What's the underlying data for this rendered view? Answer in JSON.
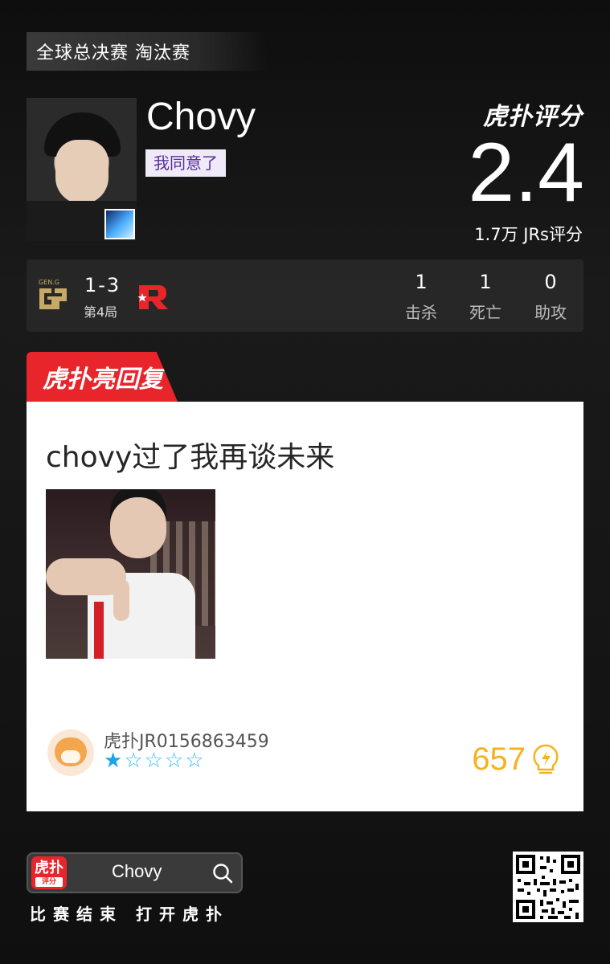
{
  "stage": "全球总决赛 淘汰赛",
  "player": {
    "name": "Chovy",
    "tag": "我同意了"
  },
  "rating": {
    "brand": "虎扑评分",
    "score": "2.4",
    "count": "1.7万 JRs评分"
  },
  "match": {
    "score": "1-3",
    "game": "第4局",
    "stats": [
      {
        "value": "1",
        "label": "击杀"
      },
      {
        "value": "1",
        "label": "死亡"
      },
      {
        "value": "0",
        "label": "助攻"
      }
    ]
  },
  "highlight": {
    "tab": "虎扑亮回复",
    "text": "chovy过了我再谈未来",
    "user": "虎扑JR0156863459",
    "stars": {
      "filled": 1,
      "total": 5
    },
    "likes": "657"
  },
  "footer": {
    "app_icon": "虎扑",
    "app_icon_sub": "评分",
    "search": "Chovy",
    "caption": "比赛结束 打开虎扑"
  },
  "colors": {
    "accent_red": "#e8252a",
    "likes_gold": "#f6b21e",
    "star_blue": "#1aa6e8",
    "tag_purple": "#5a2e9c"
  }
}
